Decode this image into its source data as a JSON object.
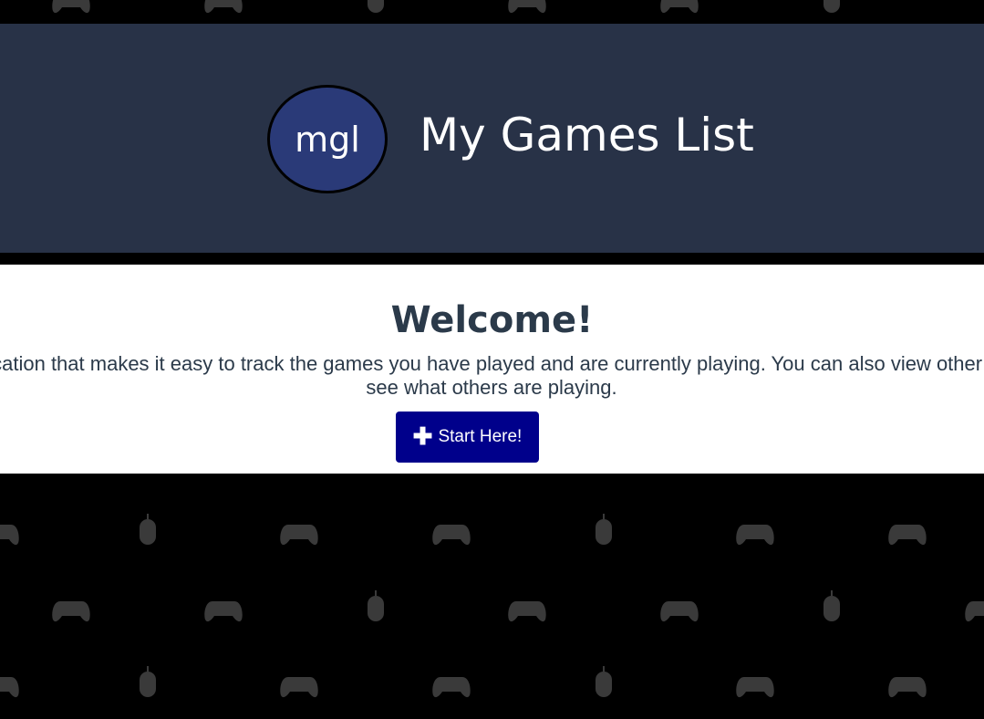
{
  "header": {
    "logo_text": "mgl",
    "title": "My Games List"
  },
  "welcome": {
    "title": "Welcome!",
    "description": "A simple application that makes it easy to track the games you have played and are currently playing. You can also view other players lists to see what others are playing.",
    "start_button": {
      "icon": "plus-icon",
      "label": "Start Here!"
    }
  },
  "colors": {
    "page_background": "#000000",
    "header_background": "#283247",
    "logo_background": "#2a3a78",
    "welcome_background": "#ffffff",
    "text_dark": "#2b3a4a",
    "button_background": "#00008b",
    "pattern_icon": "#3a3a3a"
  }
}
